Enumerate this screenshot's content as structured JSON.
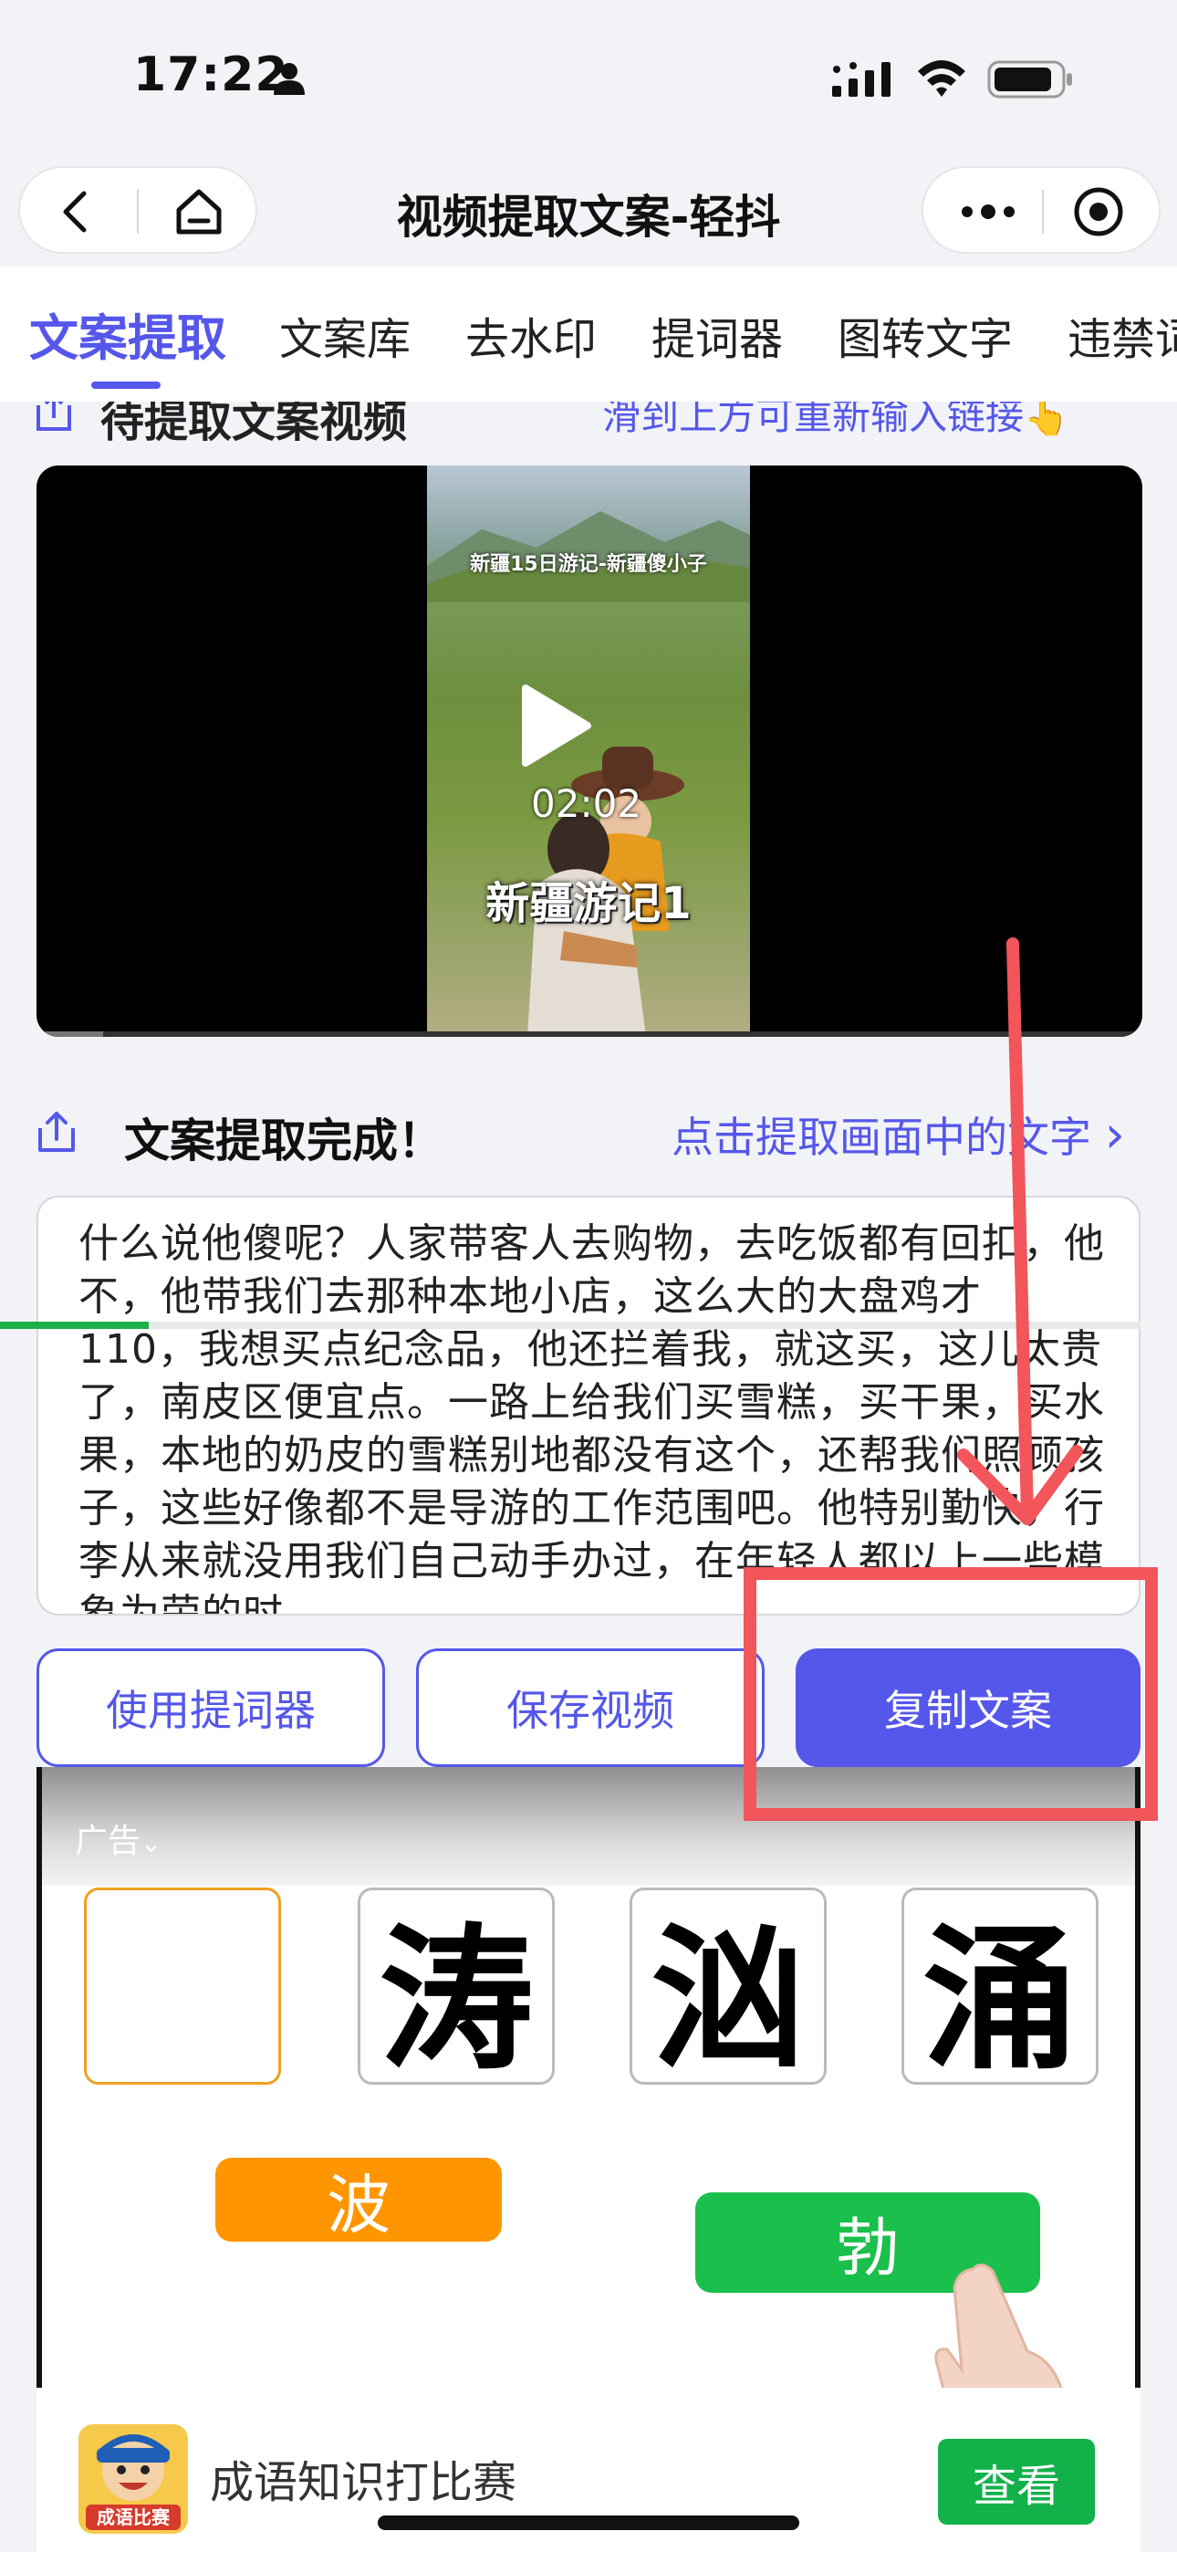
{
  "status_bar": {
    "time": "17:22"
  },
  "nav": {
    "title": "视频提取文案-轻抖"
  },
  "tabs": [
    {
      "label": "文案提取",
      "active": true
    },
    {
      "label": "文案库"
    },
    {
      "label": "去水印"
    },
    {
      "label": "提词器"
    },
    {
      "label": "图转文字"
    },
    {
      "label": "违禁词"
    }
  ],
  "section_video": {
    "title": "待提取文案视频",
    "hint": "滑到上方可重新输入链接",
    "hint_emoji": "👆",
    "video": {
      "caption": "新疆15日游记-新疆傻小子",
      "title": "新疆游记1",
      "duration": "02:02",
      "progress_fraction": 0.06
    }
  },
  "section_result": {
    "title": "文案提取完成！",
    "link": "点击提取画面中的文字",
    "link_chevron": "›",
    "text": "什么说他傻呢？人家带客人去购物，去吃饭都有回扣，他不，他带我们去那种本地小店，这么大的大盘鸡才 110，我想买点纪念品，他还拦着我，就这买，这儿太贵了，南皮区便宜点。一路上给我们买雪糕，买干果，买水果，本地的奶皮的雪糕别地都没有这个，还帮我们照顾孩子，这些好像都不是导游的工作范围吧。他特别勤快，行李从来就没用我们自己动手办过，在年轻人都以上一些模象为荣的时"
  },
  "actions": {
    "teleprompter": "使用提词器",
    "save_video": "保存视频",
    "copy_text": "复制文案"
  },
  "ad": {
    "tag": "广告",
    "characters": [
      "",
      "涛",
      "汹",
      "涌"
    ],
    "options": [
      {
        "label": "波",
        "color": "#ff9500"
      },
      {
        "label": "勃",
        "color": "#1bbf4b"
      }
    ],
    "progress_fraction": 0.13,
    "app_name": "成语知识打比赛",
    "logo_text": "成语比赛",
    "cta": "查看"
  },
  "colors": {
    "accent": "#5557ea",
    "annotation": "#f2555a",
    "ad_cta": "#12b14a"
  }
}
